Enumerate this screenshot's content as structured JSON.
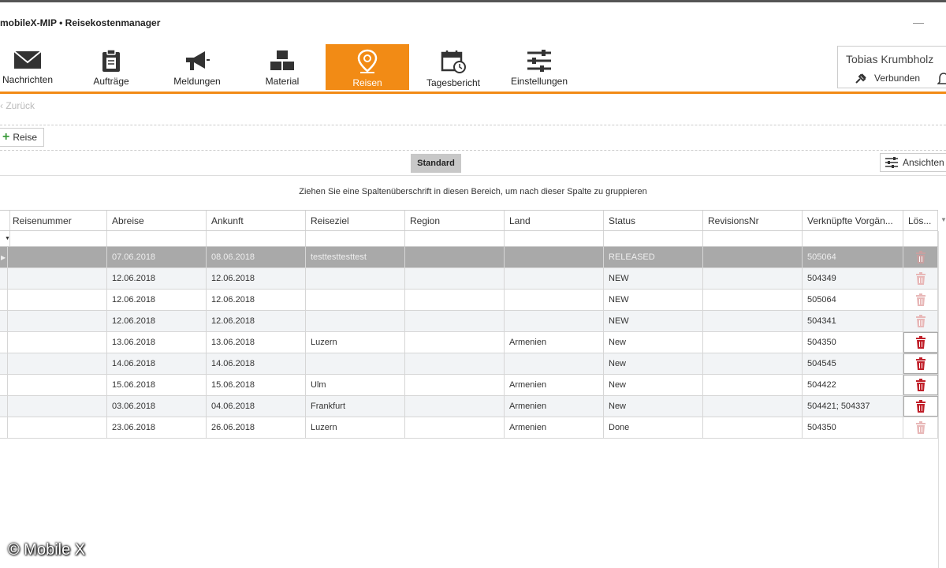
{
  "window": {
    "title": "mobileX-MIP • Reisekostenmanager",
    "minimize_glyph": "—"
  },
  "toolbar": {
    "items": [
      {
        "label": "Nachrichten",
        "icon": "envelope-icon"
      },
      {
        "label": "Aufträge",
        "icon": "clipboard-icon"
      },
      {
        "label": "Meldungen",
        "icon": "megaphone-icon"
      },
      {
        "label": "Material",
        "icon": "boxes-icon"
      },
      {
        "label": "Reisen",
        "icon": "map-pin-icon",
        "active": true
      },
      {
        "label": "Tagesbericht",
        "icon": "calendar-clock-icon"
      },
      {
        "label": "Einstellungen",
        "icon": "sliders-icon"
      }
    ],
    "active_color": "#f28b15"
  },
  "user": {
    "name": "Tobias Krumbholz",
    "status": "Verbunden"
  },
  "nav": {
    "back_label": "Zurück"
  },
  "actions": {
    "add_label": "Reise"
  },
  "view": {
    "standard_label": "Standard",
    "views_label": "Ansichten"
  },
  "grid": {
    "group_hint": "Ziehen Sie eine Spaltenüberschrift in diesen Bereich, um nach dieser Spalte zu gruppieren",
    "columns": [
      "Reisenummer",
      "Abreise",
      "Ankunft",
      "Reiseziel",
      "Region",
      "Land",
      "Status",
      "RevisionsNr",
      "Verknüpfte Vorgän...",
      "Lös..."
    ],
    "rows": [
      {
        "reisenummer": "",
        "abreise": "07.06.2018",
        "ankunft": "08.06.2018",
        "reiseziel": "testtesttesttest",
        "region": "",
        "land": "",
        "status": "RELEASED",
        "revisionsnr": "",
        "vorgaenge": "505064",
        "delete_enabled": false
      },
      {
        "reisenummer": "",
        "abreise": "12.06.2018",
        "ankunft": "12.06.2018",
        "reiseziel": "",
        "region": "",
        "land": "",
        "status": "NEW",
        "revisionsnr": "",
        "vorgaenge": "504349",
        "delete_enabled": false
      },
      {
        "reisenummer": "",
        "abreise": "12.06.2018",
        "ankunft": "12.06.2018",
        "reiseziel": "",
        "region": "",
        "land": "",
        "status": "NEW",
        "revisionsnr": "",
        "vorgaenge": "505064",
        "delete_enabled": false
      },
      {
        "reisenummer": "",
        "abreise": "12.06.2018",
        "ankunft": "12.06.2018",
        "reiseziel": "",
        "region": "",
        "land": "",
        "status": "NEW",
        "revisionsnr": "",
        "vorgaenge": "504341",
        "delete_enabled": false
      },
      {
        "reisenummer": "",
        "abreise": "13.06.2018",
        "ankunft": "13.06.2018",
        "reiseziel": "Luzern",
        "region": "",
        "land": "Armenien",
        "status": "New",
        "revisionsnr": "",
        "vorgaenge": "504350",
        "delete_enabled": true
      },
      {
        "reisenummer": "",
        "abreise": "14.06.2018",
        "ankunft": "14.06.2018",
        "reiseziel": "",
        "region": "",
        "land": "",
        "status": "New",
        "revisionsnr": "",
        "vorgaenge": "504545",
        "delete_enabled": true
      },
      {
        "reisenummer": "",
        "abreise": "15.06.2018",
        "ankunft": "15.06.2018",
        "reiseziel": "Ulm",
        "region": "",
        "land": "Armenien",
        "status": "New",
        "revisionsnr": "",
        "vorgaenge": "504422",
        "delete_enabled": true
      },
      {
        "reisenummer": "",
        "abreise": "03.06.2018",
        "ankunft": "04.06.2018",
        "reiseziel": "Frankfurt",
        "region": "",
        "land": "Armenien",
        "status": "New",
        "revisionsnr": "",
        "vorgaenge": "504421; 504337",
        "delete_enabled": true
      },
      {
        "reisenummer": "",
        "abreise": "23.06.2018",
        "ankunft": "26.06.2018",
        "reiseziel": "Luzern",
        "region": "",
        "land": "Armenien",
        "status": "Done",
        "revisionsnr": "",
        "vorgaenge": "504350",
        "delete_enabled": false
      }
    ]
  },
  "watermark": "© Mobile X"
}
